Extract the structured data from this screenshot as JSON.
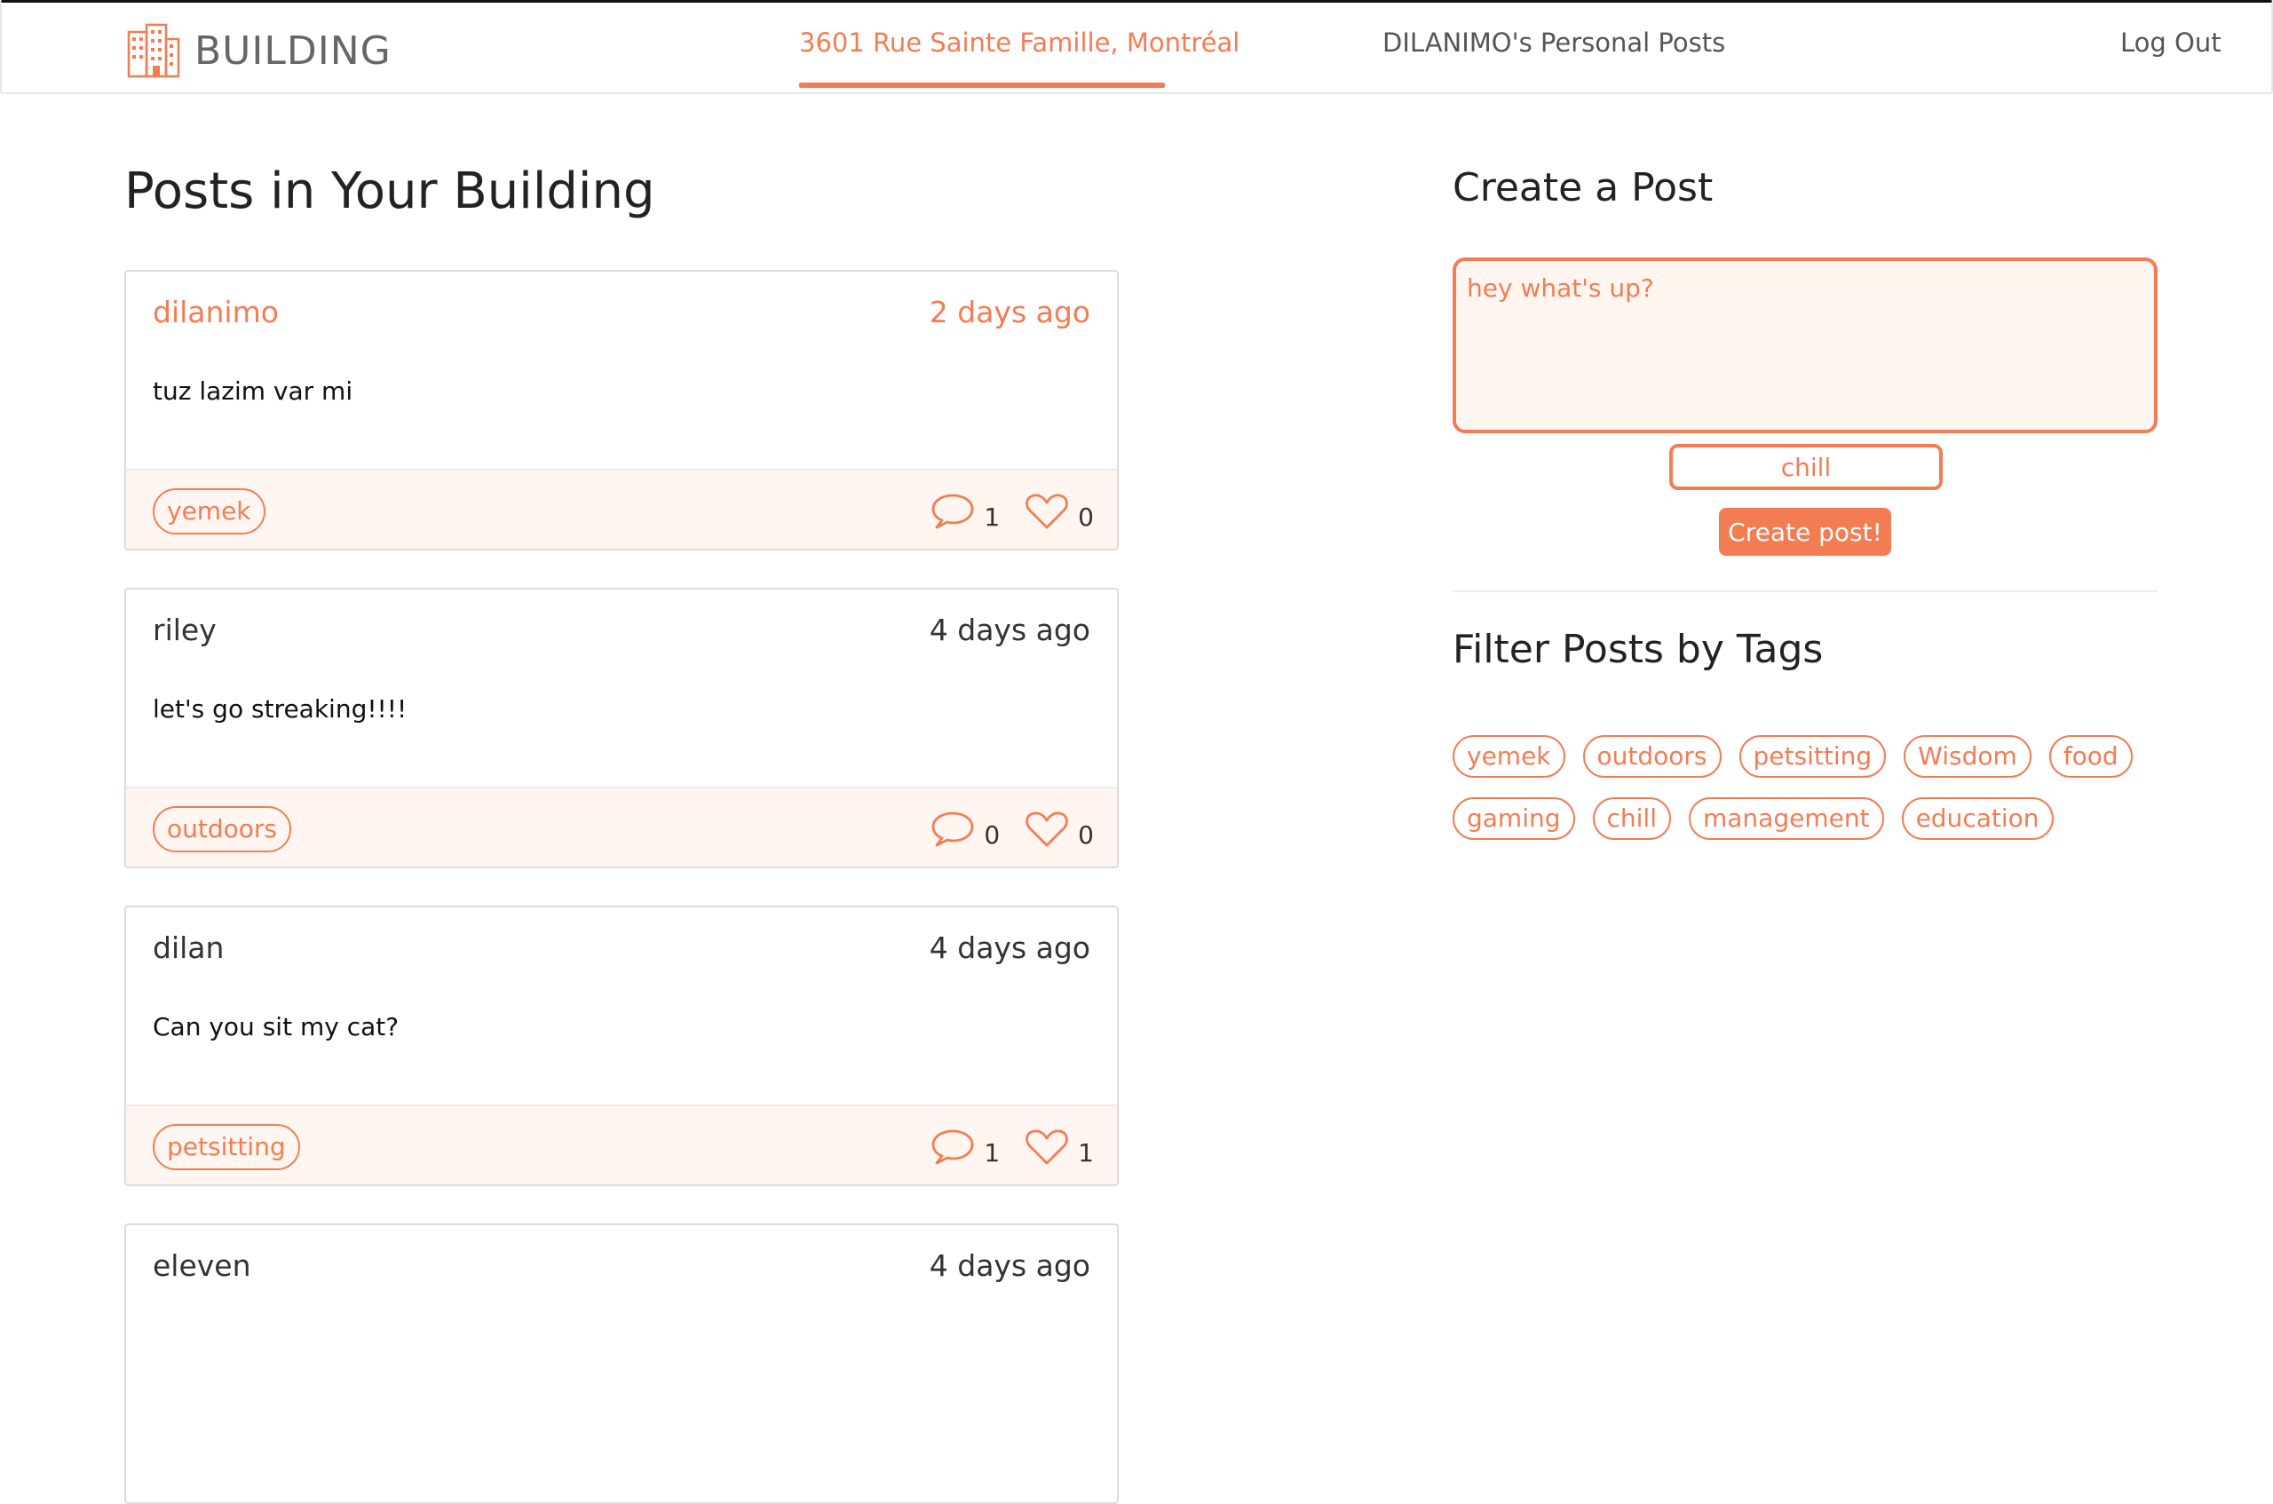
{
  "nav": {
    "brand": "BUILDING",
    "address": "3601 Rue Sainte Famille, Montréal",
    "personal_posts": "DILANIMO's Personal Posts",
    "logout": "Log Out"
  },
  "feed": {
    "title": "Posts in Your Building",
    "posts": [
      {
        "author": "dilanimo",
        "time": "2 days ago",
        "body": "tuz lazim var mi",
        "tag": "yemek",
        "comments": "1",
        "likes": "0"
      },
      {
        "author": "riley",
        "time": "4 days ago",
        "body": "let's go streaking!!!!",
        "tag": "outdoors",
        "comments": "0",
        "likes": "0"
      },
      {
        "author": "dilan",
        "time": "4 days ago",
        "body": "Can you sit my cat?",
        "tag": "petsitting",
        "comments": "1",
        "likes": "1"
      },
      {
        "author": "eleven",
        "time": "4 days ago",
        "body": "",
        "tag": "",
        "comments": "",
        "likes": ""
      }
    ]
  },
  "create": {
    "title": "Create a Post",
    "placeholder": "hey what's up?",
    "tag_value": "chill",
    "button": "Create post!"
  },
  "filter": {
    "title": "Filter Posts by Tags",
    "tags": [
      "yemek",
      "outdoors",
      "petsitting",
      "Wisdom",
      "food",
      "gaming",
      "chill",
      "management",
      "education"
    ]
  },
  "colors": {
    "accent": "#f47c53",
    "card_footer": "#fff6f1"
  },
  "icons": {
    "brand": "building-icon",
    "comment": "comment-bubble-icon",
    "like": "heart-icon"
  }
}
